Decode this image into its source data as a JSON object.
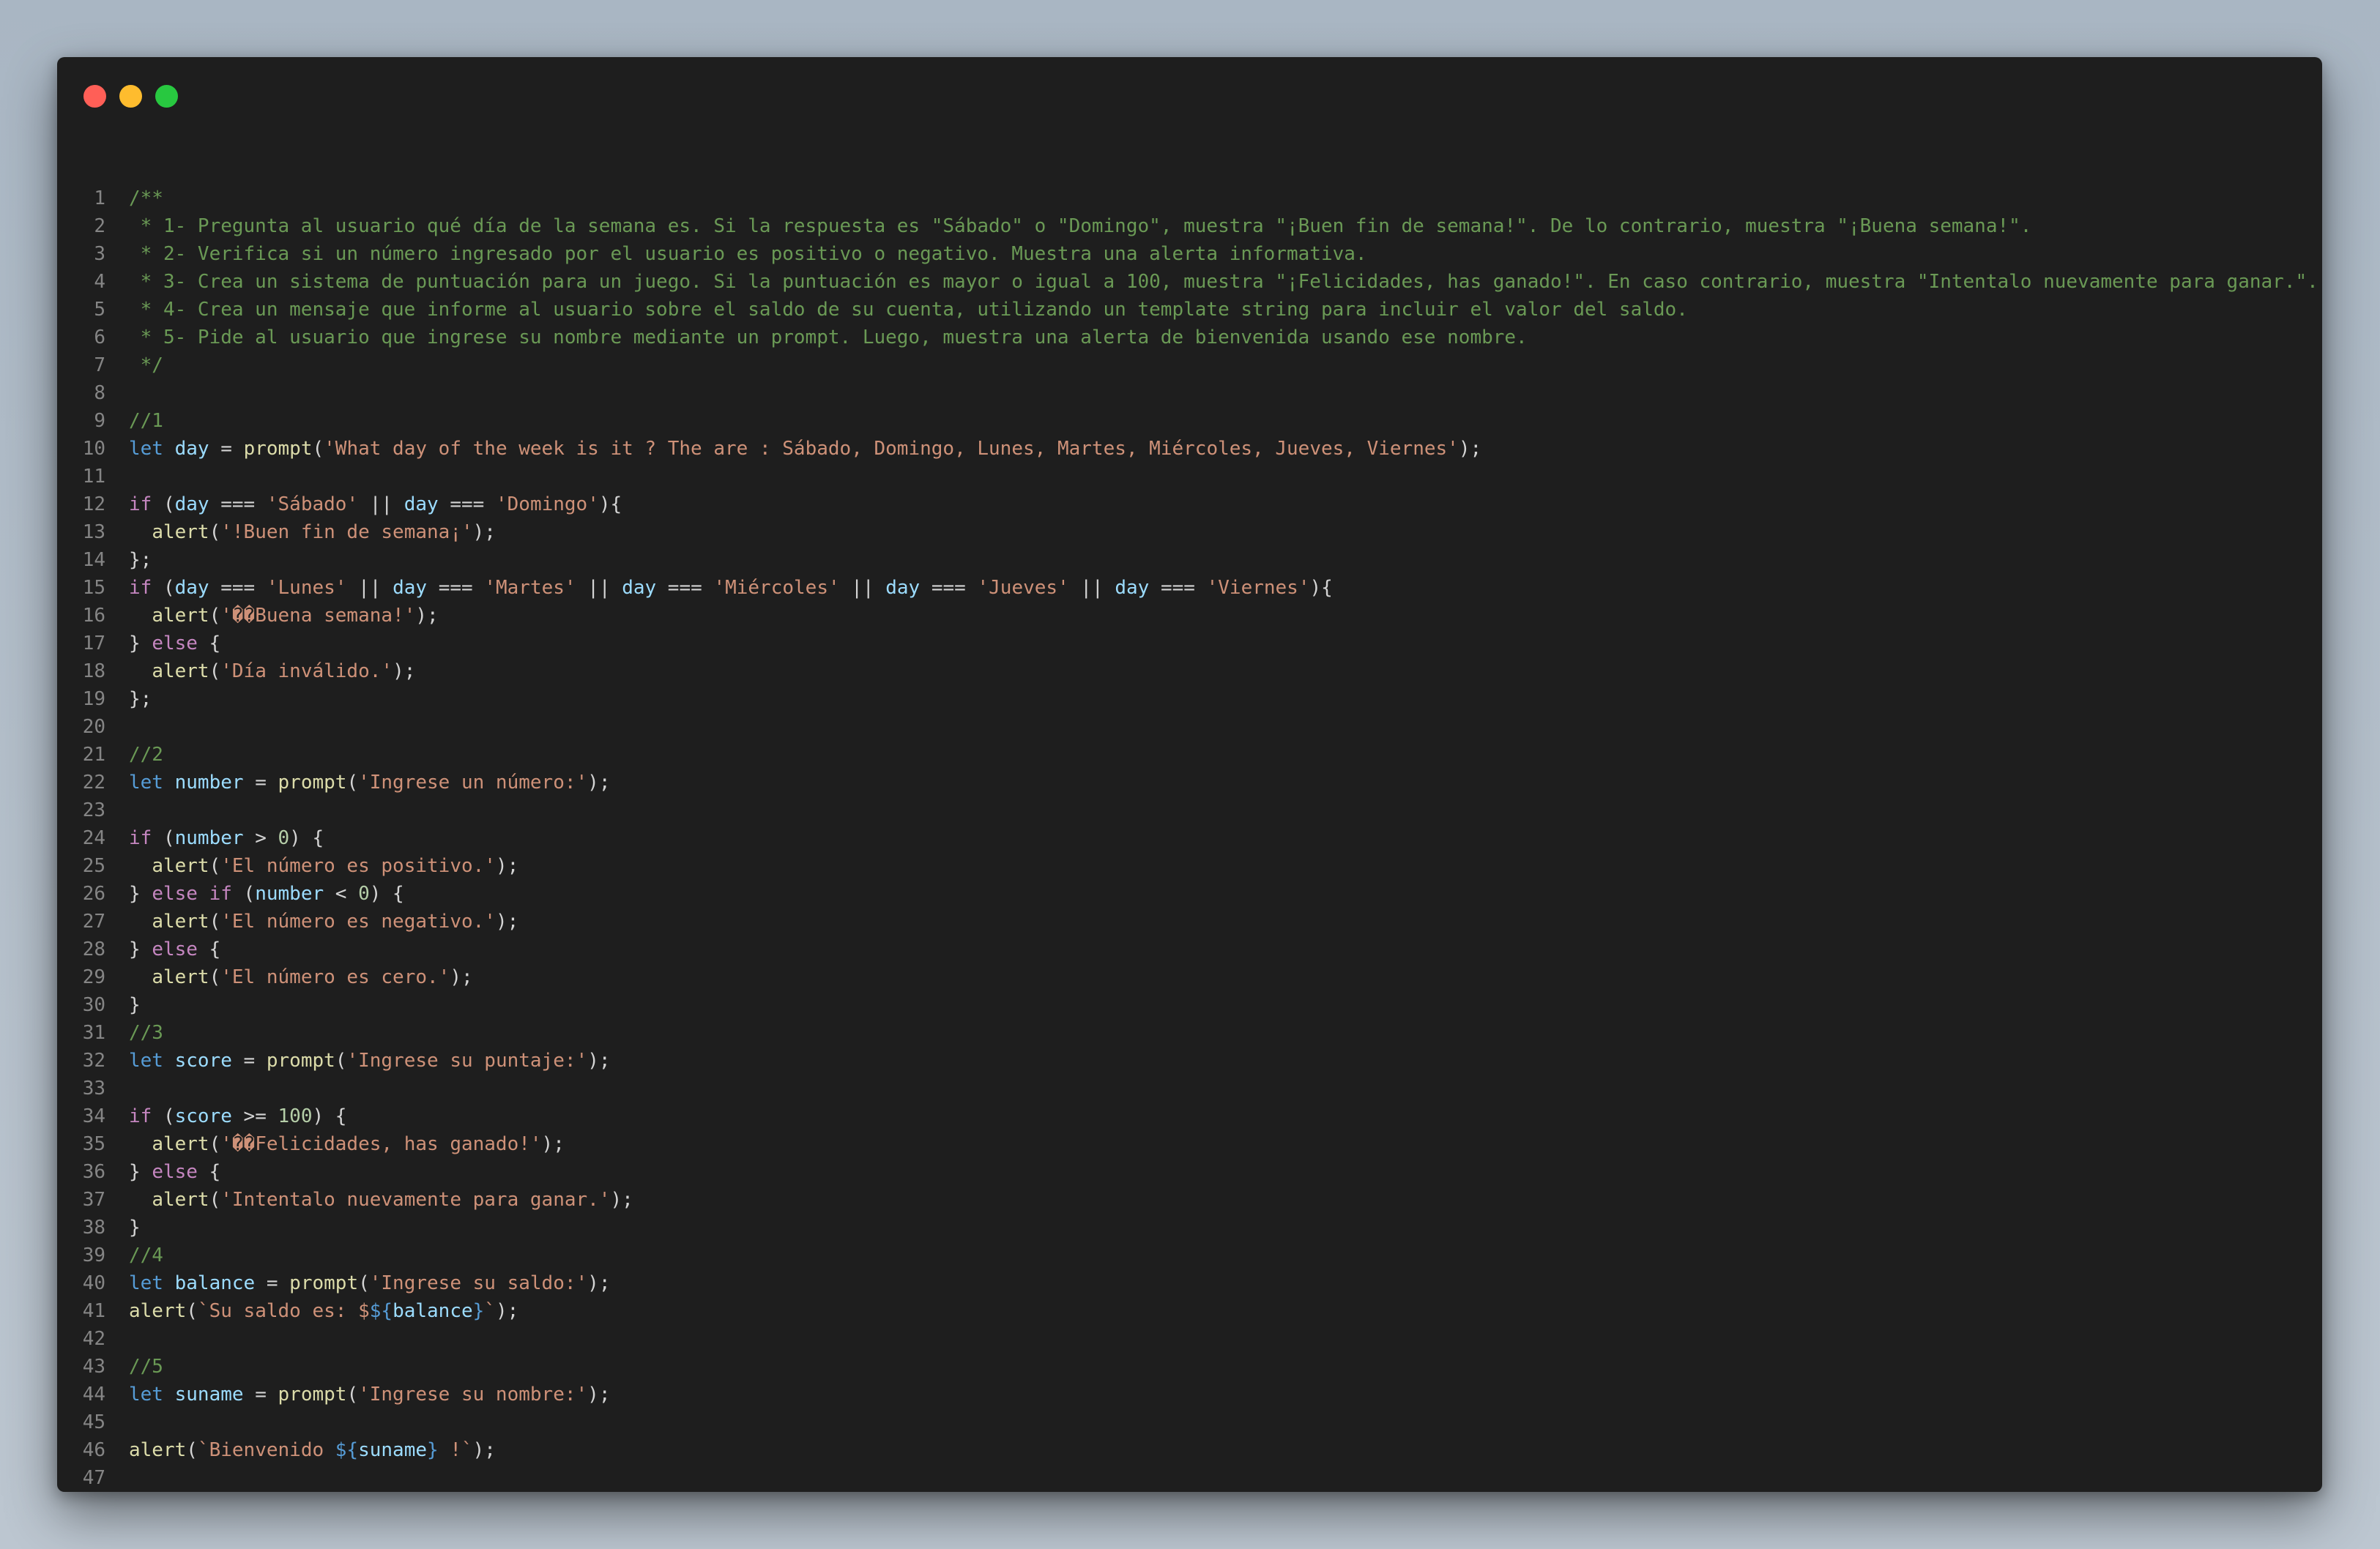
{
  "window": {
    "controls": [
      {
        "name": "close-button",
        "color": "#ff5f57"
      },
      {
        "name": "minimize-button",
        "color": "#febc2e"
      },
      {
        "name": "zoom-button",
        "color": "#28c840"
      }
    ]
  },
  "colors": {
    "comment": "#6a9955",
    "keyword": "#569cd6",
    "control": "#c586c0",
    "variable": "#9cdcfe",
    "function": "#dcdcaa",
    "string": "#ce9178",
    "number": "#b5cea8",
    "plain": "#d4d4d4",
    "linenumber": "#858585"
  },
  "code_lines": [
    [
      [
        "c",
        "/**"
      ]
    ],
    [
      [
        "c",
        " * 1- Pregunta al usuario qué día de la semana es. Si la respuesta es \"Sábado\" o \"Domingo\", muestra \"¡Buen fin de semana!\". De lo contrario, muestra \"¡Buena semana!\"."
      ]
    ],
    [
      [
        "c",
        " * 2- Verifica si un número ingresado por el usuario es positivo o negativo. Muestra una alerta informativa."
      ]
    ],
    [
      [
        "c",
        " * 3- Crea un sistema de puntuación para un juego. Si la puntuación es mayor o igual a 100, muestra \"¡Felicidades, has ganado!\". En caso contrario, muestra \"Intentalo nuevamente para ganar.\"."
      ]
    ],
    [
      [
        "c",
        " * 4- Crea un mensaje que informe al usuario sobre el saldo de su cuenta, utilizando un template string para incluir el valor del saldo."
      ]
    ],
    [
      [
        "c",
        " * 5- Pide al usuario que ingrese su nombre mediante un prompt. Luego, muestra una alerta de bienvenida usando ese nombre."
      ]
    ],
    [
      [
        "c",
        " */"
      ]
    ],
    [],
    [
      [
        "c",
        "//1"
      ]
    ],
    [
      [
        "k",
        "let"
      ],
      [
        "p",
        " "
      ],
      [
        "v",
        "day"
      ],
      [
        "p",
        " = "
      ],
      [
        "f",
        "prompt"
      ],
      [
        "p",
        "("
      ],
      [
        "s",
        "'What day of the week is it ? The are : Sábado, Domingo, Lunes, Martes, Miércoles, Jueves, Viernes'"
      ],
      [
        "p",
        ");"
      ]
    ],
    [],
    [
      [
        "x",
        "if"
      ],
      [
        "p",
        " ("
      ],
      [
        "v",
        "day"
      ],
      [
        "p",
        " === "
      ],
      [
        "s",
        "'Sábado'"
      ],
      [
        "p",
        " || "
      ],
      [
        "v",
        "day"
      ],
      [
        "p",
        " === "
      ],
      [
        "s",
        "'Domingo'"
      ],
      [
        "p",
        "){"
      ]
    ],
    [
      [
        "p",
        "  "
      ],
      [
        "f",
        "alert"
      ],
      [
        "p",
        "("
      ],
      [
        "s",
        "'!Buen fin de semana¡'"
      ],
      [
        "p",
        ");"
      ]
    ],
    [
      [
        "p",
        "};"
      ]
    ],
    [
      [
        "x",
        "if"
      ],
      [
        "p",
        " ("
      ],
      [
        "v",
        "day"
      ],
      [
        "p",
        " === "
      ],
      [
        "s",
        "'Lunes'"
      ],
      [
        "p",
        " || "
      ],
      [
        "v",
        "day"
      ],
      [
        "p",
        " === "
      ],
      [
        "s",
        "'Martes'"
      ],
      [
        "p",
        " || "
      ],
      [
        "v",
        "day"
      ],
      [
        "p",
        " === "
      ],
      [
        "s",
        "'Miércoles'"
      ],
      [
        "p",
        " || "
      ],
      [
        "v",
        "day"
      ],
      [
        "p",
        " === "
      ],
      [
        "s",
        "'Jueves'"
      ],
      [
        "p",
        " || "
      ],
      [
        "v",
        "day"
      ],
      [
        "p",
        " === "
      ],
      [
        "s",
        "'Viernes'"
      ],
      [
        "p",
        "){"
      ]
    ],
    [
      [
        "p",
        "  "
      ],
      [
        "f",
        "alert"
      ],
      [
        "p",
        "("
      ],
      [
        "s",
        "'��Buena semana!'"
      ],
      [
        "p",
        ");"
      ]
    ],
    [
      [
        "p",
        "} "
      ],
      [
        "x",
        "else"
      ],
      [
        "p",
        " {"
      ]
    ],
    [
      [
        "p",
        "  "
      ],
      [
        "f",
        "alert"
      ],
      [
        "p",
        "("
      ],
      [
        "s",
        "'Día inválido.'"
      ],
      [
        "p",
        ");"
      ]
    ],
    [
      [
        "p",
        "};"
      ]
    ],
    [],
    [
      [
        "c",
        "//2"
      ]
    ],
    [
      [
        "k",
        "let"
      ],
      [
        "p",
        " "
      ],
      [
        "v",
        "number"
      ],
      [
        "p",
        " = "
      ],
      [
        "f",
        "prompt"
      ],
      [
        "p",
        "("
      ],
      [
        "s",
        "'Ingrese un número:'"
      ],
      [
        "p",
        ");"
      ]
    ],
    [],
    [
      [
        "x",
        "if"
      ],
      [
        "p",
        " ("
      ],
      [
        "v",
        "number"
      ],
      [
        "p",
        " > "
      ],
      [
        "n",
        "0"
      ],
      [
        "p",
        ") {"
      ]
    ],
    [
      [
        "p",
        "  "
      ],
      [
        "f",
        "alert"
      ],
      [
        "p",
        "("
      ],
      [
        "s",
        "'El número es positivo.'"
      ],
      [
        "p",
        ");"
      ]
    ],
    [
      [
        "p",
        "} "
      ],
      [
        "x",
        "else if"
      ],
      [
        "p",
        " ("
      ],
      [
        "v",
        "number"
      ],
      [
        "p",
        " < "
      ],
      [
        "n",
        "0"
      ],
      [
        "p",
        ") {"
      ]
    ],
    [
      [
        "p",
        "  "
      ],
      [
        "f",
        "alert"
      ],
      [
        "p",
        "("
      ],
      [
        "s",
        "'El número es negativo.'"
      ],
      [
        "p",
        ");"
      ]
    ],
    [
      [
        "p",
        "} "
      ],
      [
        "x",
        "else"
      ],
      [
        "p",
        " {"
      ]
    ],
    [
      [
        "p",
        "  "
      ],
      [
        "f",
        "alert"
      ],
      [
        "p",
        "("
      ],
      [
        "s",
        "'El número es cero.'"
      ],
      [
        "p",
        ");"
      ]
    ],
    [
      [
        "p",
        "}"
      ]
    ],
    [
      [
        "c",
        "//3"
      ]
    ],
    [
      [
        "k",
        "let"
      ],
      [
        "p",
        " "
      ],
      [
        "v",
        "score"
      ],
      [
        "p",
        " = "
      ],
      [
        "f",
        "prompt"
      ],
      [
        "p",
        "("
      ],
      [
        "s",
        "'Ingrese su puntaje:'"
      ],
      [
        "p",
        ");"
      ]
    ],
    [],
    [
      [
        "x",
        "if"
      ],
      [
        "p",
        " ("
      ],
      [
        "v",
        "score"
      ],
      [
        "p",
        " >= "
      ],
      [
        "n",
        "100"
      ],
      [
        "p",
        ") {"
      ]
    ],
    [
      [
        "p",
        "  "
      ],
      [
        "f",
        "alert"
      ],
      [
        "p",
        "("
      ],
      [
        "s",
        "'��Felicidades, has ganado!'"
      ],
      [
        "p",
        ");"
      ]
    ],
    [
      [
        "p",
        "} "
      ],
      [
        "x",
        "else"
      ],
      [
        "p",
        " {"
      ]
    ],
    [
      [
        "p",
        "  "
      ],
      [
        "f",
        "alert"
      ],
      [
        "p",
        "("
      ],
      [
        "s",
        "'Intentalo nuevamente para ganar.'"
      ],
      [
        "p",
        ");"
      ]
    ],
    [
      [
        "p",
        "}"
      ]
    ],
    [
      [
        "c",
        "//4"
      ]
    ],
    [
      [
        "k",
        "let"
      ],
      [
        "p",
        " "
      ],
      [
        "v",
        "balance"
      ],
      [
        "p",
        " = "
      ],
      [
        "f",
        "prompt"
      ],
      [
        "p",
        "("
      ],
      [
        "s",
        "'Ingrese su saldo:'"
      ],
      [
        "p",
        ");"
      ]
    ],
    [
      [
        "f",
        "alert"
      ],
      [
        "p",
        "("
      ],
      [
        "s",
        "`Su saldo es: $"
      ],
      [
        "k",
        "${"
      ],
      [
        "v",
        "balance"
      ],
      [
        "k",
        "}"
      ],
      [
        "s",
        "`"
      ],
      [
        "p",
        ");"
      ]
    ],
    [],
    [
      [
        "c",
        "//5"
      ]
    ],
    [
      [
        "k",
        "let"
      ],
      [
        "p",
        " "
      ],
      [
        "v",
        "suname"
      ],
      [
        "p",
        " = "
      ],
      [
        "f",
        "prompt"
      ],
      [
        "p",
        "("
      ],
      [
        "s",
        "'Ingrese su nombre:'"
      ],
      [
        "p",
        ");"
      ]
    ],
    [],
    [
      [
        "f",
        "alert"
      ],
      [
        "p",
        "("
      ],
      [
        "s",
        "`Bienvenido "
      ],
      [
        "k",
        "${"
      ],
      [
        "v",
        "suname"
      ],
      [
        "k",
        "}"
      ],
      [
        "s",
        " !`"
      ],
      [
        "p",
        ");"
      ]
    ],
    [],
    []
  ]
}
